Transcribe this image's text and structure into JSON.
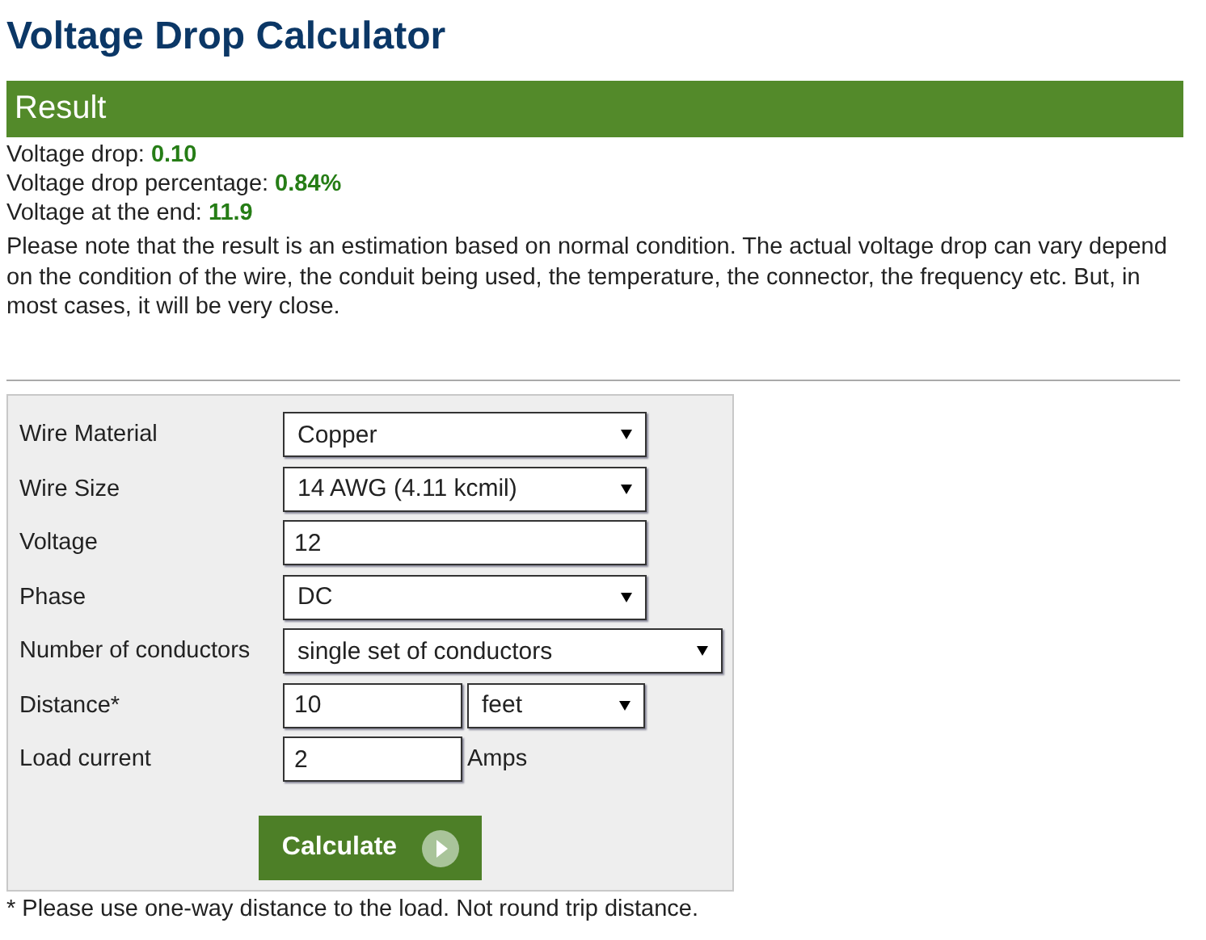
{
  "title": "Voltage Drop Calculator",
  "result": {
    "heading": "Result",
    "lines": [
      {
        "label": "Voltage drop:",
        "value": "0.10"
      },
      {
        "label": "Voltage drop percentage:",
        "value": "0.84%"
      },
      {
        "label": "Voltage at the end:",
        "value": "11.9"
      }
    ],
    "note": "Please note that the result is an estimation based on normal condition. The actual voltage drop can vary depend on the condition of the wire, the conduit being used, the temperature, the connector, the frequency etc. But, in most cases, it will be very close."
  },
  "form": {
    "rows": [
      {
        "kind": "select",
        "label": "Wire Material",
        "value": "Copper"
      },
      {
        "kind": "select",
        "label": "Wire Size",
        "value": "14 AWG (4.11 kcmil)"
      },
      {
        "kind": "input",
        "label": "Voltage",
        "value": "12"
      },
      {
        "kind": "select",
        "label": "Phase",
        "value": "DC"
      },
      {
        "kind": "wide-select",
        "label": "Number of conductors",
        "value": "single set of conductors"
      },
      {
        "kind": "input-select",
        "label": "Distance*",
        "value": "10",
        "unit": "feet"
      },
      {
        "kind": "input-unit",
        "label": "Load current",
        "value": "2",
        "unit": "Amps"
      }
    ],
    "button": "Calculate"
  },
  "footnote": "* Please use one-way distance to the load. Not round trip distance."
}
